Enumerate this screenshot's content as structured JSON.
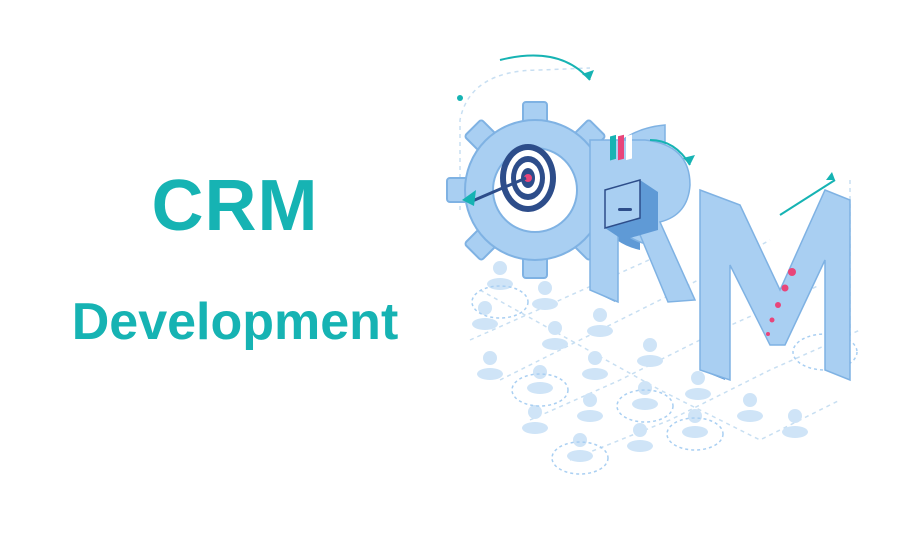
{
  "banner": {
    "title": "CRM",
    "subtitle": "Development"
  },
  "illustration": {
    "name": "isometric-crm-illustration",
    "elements": [
      "gear-icon",
      "target-icon",
      "file-drawer-icon",
      "growth-arrow-icon",
      "user-icon"
    ]
  },
  "colors": {
    "brand": "#16b3b3",
    "letter_face": "#a9cff2",
    "letter_side": "#5f9ad6",
    "dots": "#e8457a",
    "users": "#cfe4f7"
  }
}
